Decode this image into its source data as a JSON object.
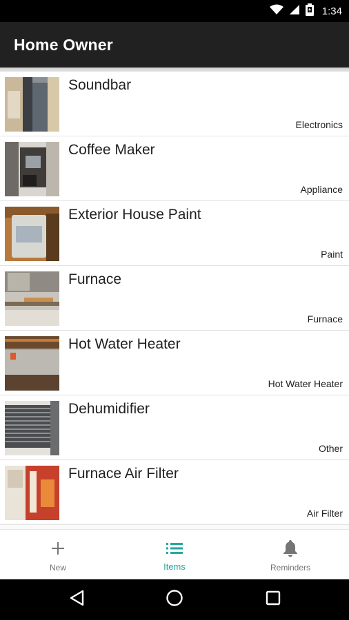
{
  "status_bar": {
    "time": "1:34",
    "icons": [
      "wifi-icon",
      "signal-icon",
      "battery-icon"
    ]
  },
  "app_bar": {
    "title": "Home Owner",
    "color": "#212121"
  },
  "items": [
    {
      "name": "Soundbar",
      "category": "Electronics",
      "thumb": "soundbar-photo"
    },
    {
      "name": "Coffee Maker",
      "category": "Appliance",
      "thumb": "coffee-maker-photo"
    },
    {
      "name": "Exterior House Paint",
      "category": "Paint",
      "thumb": "paint-can-photo"
    },
    {
      "name": "Furnace",
      "category": "Furnace",
      "thumb": "furnace-photo"
    },
    {
      "name": "Hot Water Heater",
      "category": "Hot Water Heater",
      "thumb": "water-heater-photo"
    },
    {
      "name": "Dehumidifier",
      "category": "Other",
      "thumb": "dehumidifier-photo"
    },
    {
      "name": "Furnace Air Filter",
      "category": "Air Filter",
      "thumb": "air-filter-photo"
    }
  ],
  "bottom_nav": {
    "tabs": [
      {
        "label": "New",
        "icon": "plus-icon",
        "active": false
      },
      {
        "label": "Items",
        "icon": "list-icon",
        "active": true
      },
      {
        "label": "Reminders",
        "icon": "bell-icon",
        "active": false
      }
    ],
    "active_color": "#26a69a",
    "inactive_color": "#757575"
  },
  "system_nav": {
    "buttons": [
      "back-icon",
      "home-icon",
      "recents-icon"
    ]
  }
}
